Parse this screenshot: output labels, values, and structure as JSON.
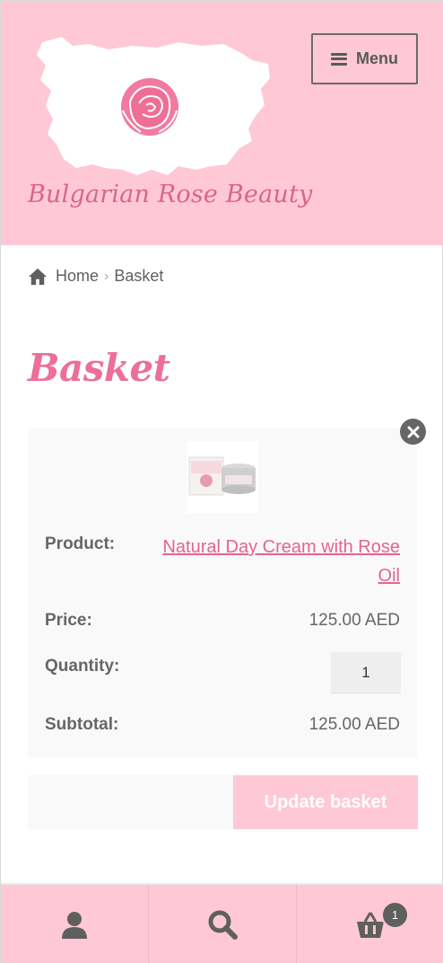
{
  "brand": {
    "name": "Bulgarian Rose Beauty",
    "colors": {
      "header_bg": "#ffc8d6",
      "accent": "#ec6f98",
      "link": "#e4648f",
      "text": "#5f5f5f"
    }
  },
  "header": {
    "menu_label": "Menu",
    "menu_icon": "hamburger-icon"
  },
  "breadcrumb": {
    "home_icon": "home-icon",
    "items": [
      "Home",
      "Basket"
    ],
    "separator": "›"
  },
  "page": {
    "title": "Basket"
  },
  "cart": {
    "remove_icon": "close-circle-icon",
    "item": {
      "product_label": "Product:",
      "product_name": "Natural Day Cream with Rose Oil",
      "price_label": "Price:",
      "price": "125.00 AED",
      "quantity_label": "Quantity:",
      "quantity": "1",
      "subtotal_label": "Subtotal:",
      "subtotal": "125.00 AED"
    },
    "update_label": "Update basket"
  },
  "footer": {
    "tabs": [
      {
        "icon": "user-icon"
      },
      {
        "icon": "search-icon"
      },
      {
        "icon": "basket-icon",
        "badge": "1"
      }
    ]
  }
}
